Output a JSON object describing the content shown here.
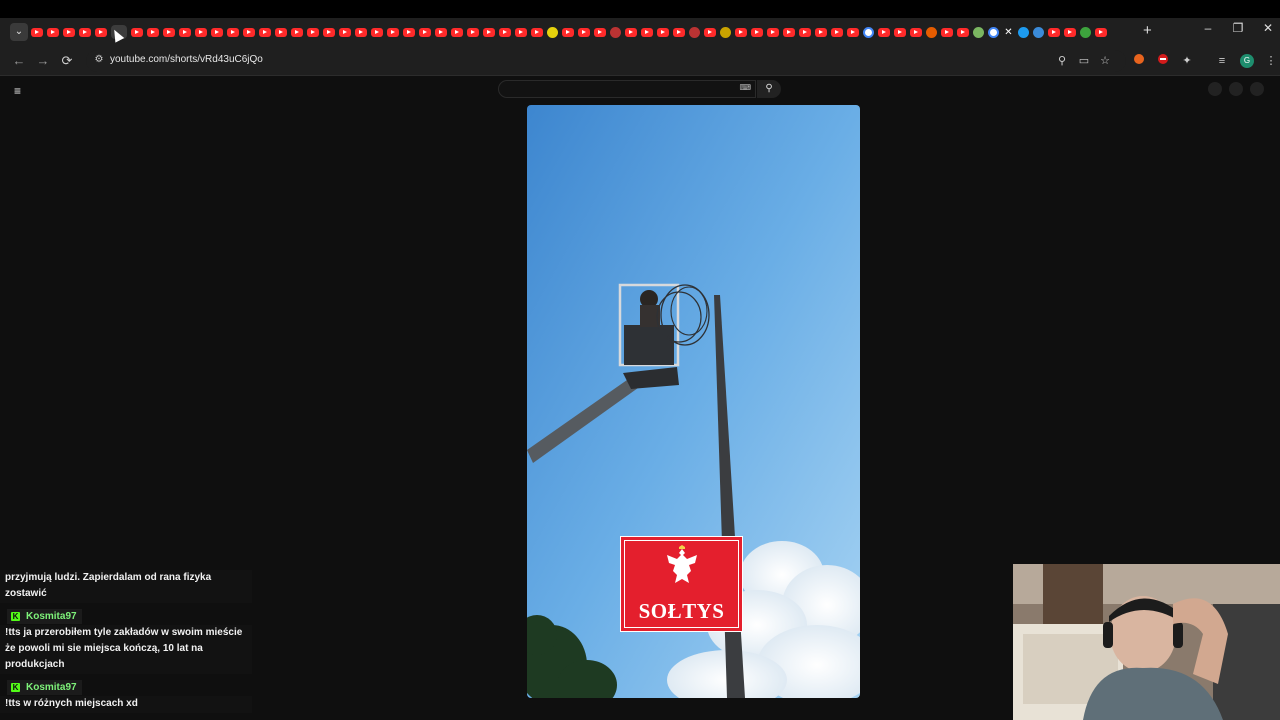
{
  "browser": {
    "tab_search_icon": "chevron-down-icon",
    "new_tab_label": "+",
    "window_controls": {
      "minimize": "–",
      "restore": "❐",
      "close": "✕"
    },
    "url": "youtube.com/shorts/vRd43uC6jQo",
    "back_icon": "←",
    "forward_icon": "→",
    "reload_icon": "⟳",
    "site_info_icon": "⚙",
    "zoom_icon": "⚲",
    "cast_icon": "▭",
    "bookmark_icon": "☆",
    "extensions_icon": "✦",
    "media_icon": "≡",
    "profile_initial": "G",
    "menu_icon": "⋮"
  },
  "youtube": {
    "menu_icon": "≡",
    "search_placeholder": "",
    "keyboard_icon": "⌨",
    "search_icon": "⚲"
  },
  "video": {
    "sign_label": "SOŁTYS"
  },
  "chat": {
    "messages": [
      {
        "text": "przyjmują ludzi. Zapierdalam od rana fizyka zostawić"
      },
      {
        "user": "Kosmita97",
        "text": "!tts ja przerobiłem tyle zakładów w swoim mieście że powoli mi sie miejsca kończą, 10 lat na produkcjach"
      },
      {
        "user": "Kosmita97",
        "text": "!tts w różnych miejscach xd"
      }
    ],
    "badge_glyph": "K"
  },
  "colors": {
    "youtube_red": "#ff2a2a",
    "sign_red": "#e41f2d",
    "chat_user": "#7ef27a",
    "kick_badge": "#53fc18"
  }
}
